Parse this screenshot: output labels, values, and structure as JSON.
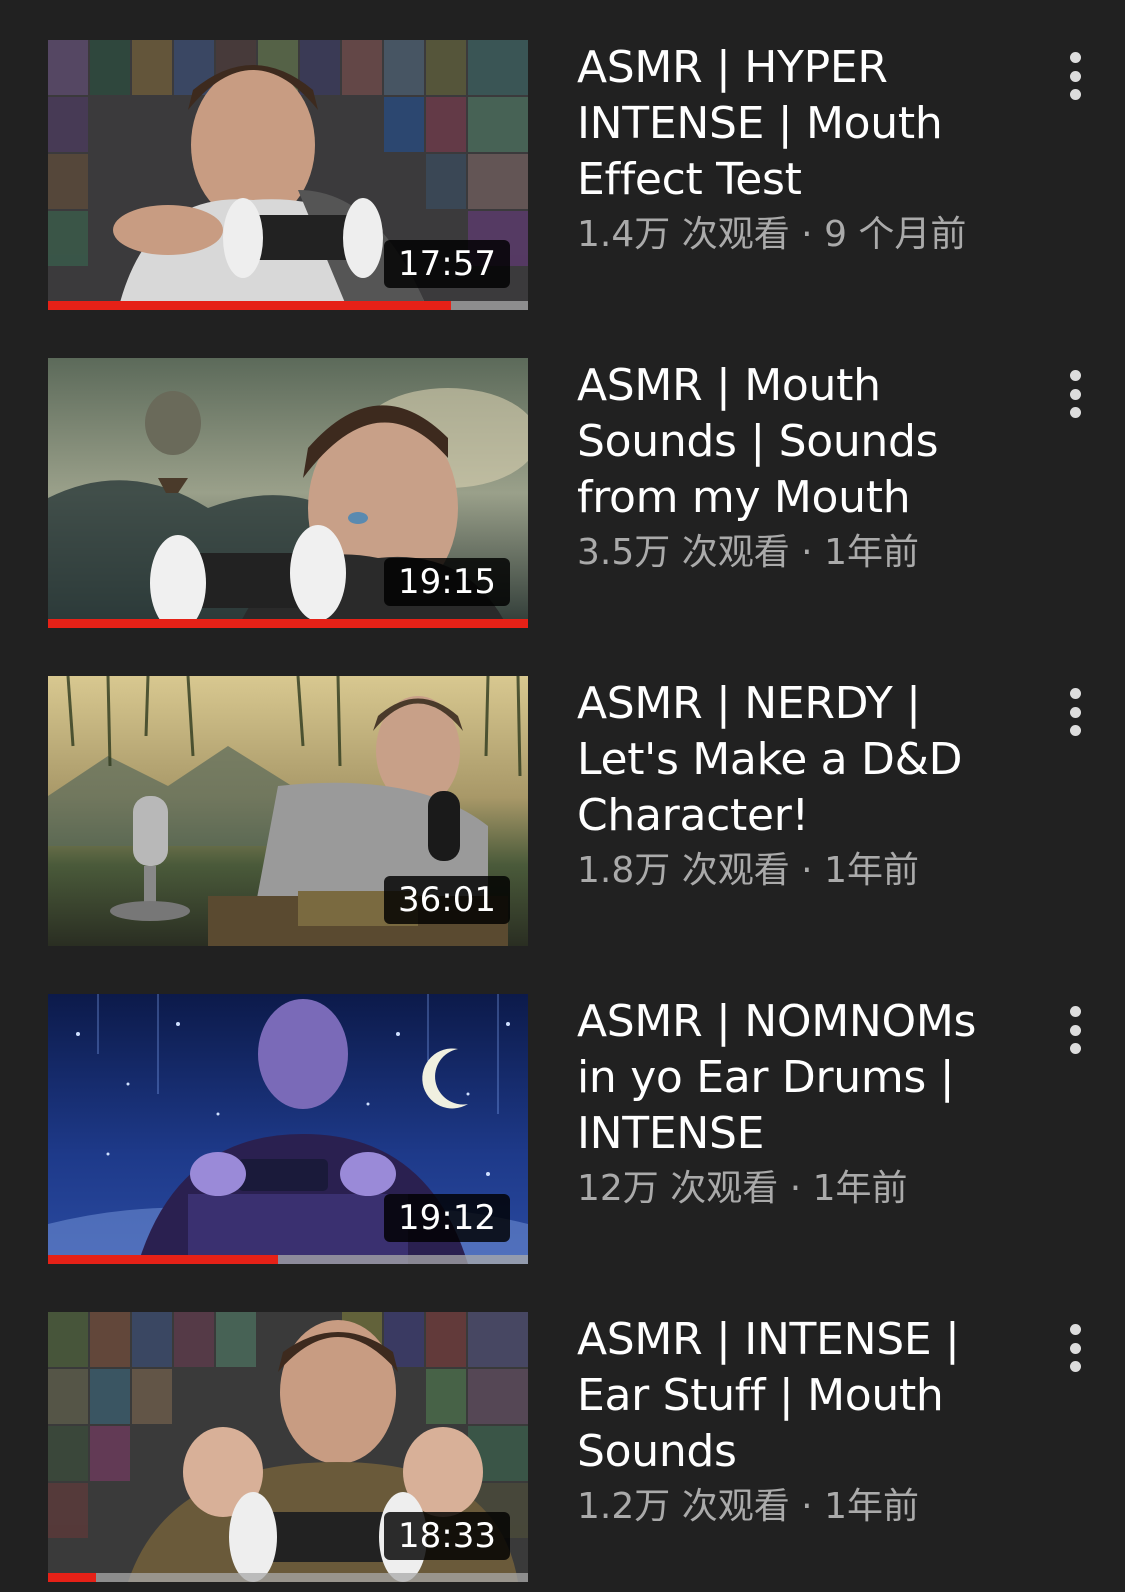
{
  "videos": [
    {
      "title": "ASMR | HYPER INTENSE | Mouth Effect Test",
      "duration": "17:57",
      "views": "1.4万 次观看",
      "separator": "·",
      "age": "9 个月前",
      "progress": 0.84,
      "thumbnail_icon": "thumbnail-man-with-binaural-mic-game-wall"
    },
    {
      "title": "ASMR | Mouth Sounds | Sounds from my Mouth",
      "duration": "19:15",
      "views": "3.5万 次观看",
      "separator": "·",
      "age": "1年前",
      "progress": 1.0,
      "thumbnail_icon": "thumbnail-man-with-binaural-mic-stormy-sky"
    },
    {
      "title": "ASMR | NERDY | Let's Make a D&D Character!",
      "duration": "36:01",
      "views": "1.8万 次观看",
      "separator": "·",
      "age": "1年前",
      "progress": 0,
      "thumbnail_icon": "thumbnail-man-with-microphones-landscape"
    },
    {
      "title": "ASMR | NOMNOMs in yo Ear Drums | INTENSE",
      "duration": "19:12",
      "views": "12万 次观看",
      "separator": "·",
      "age": "1年前",
      "progress": 0.48,
      "thumbnail_icon": "thumbnail-man-night-sky-moon"
    },
    {
      "title": "ASMR | INTENSE | Ear Stuff | Mouth Sounds",
      "duration": "18:33",
      "views": "1.2万 次观看",
      "separator": "·",
      "age": "1年前",
      "progress": 0.1,
      "thumbnail_icon": "thumbnail-man-with-binaural-mic-game-wall"
    }
  ],
  "colors": {
    "background": "#212121",
    "progress": "#e62117",
    "meta_text": "#aaaaaa",
    "title_text": "#ffffff"
  }
}
